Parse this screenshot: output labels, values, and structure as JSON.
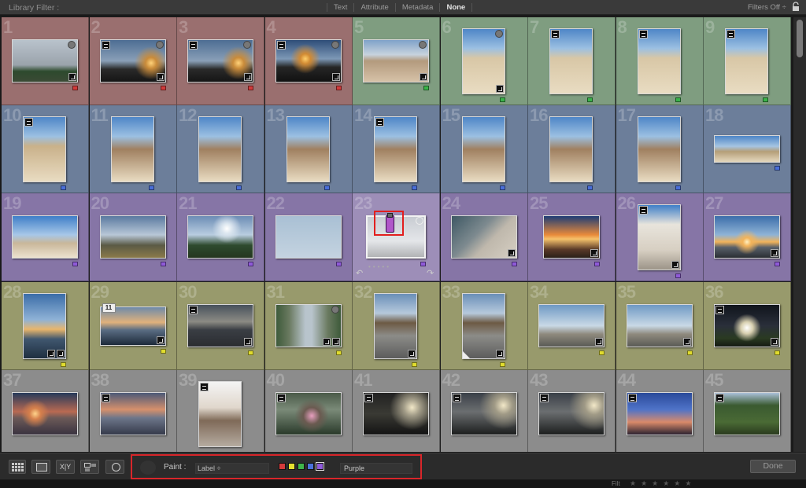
{
  "filter_bar": {
    "title": "Library Filter :",
    "tabs": [
      "Text",
      "Attribute",
      "Metadata",
      "None"
    ],
    "active_tab": "None",
    "filters_label": "Filters Off ÷"
  },
  "grid": {
    "row_colors": [
      "#9a6f6f",
      "#7a9a7a",
      "#6b7d99",
      "#8878a5",
      "#999a6b",
      "#8a8a8a"
    ],
    "label_colors": {
      "red": "#d13b3b",
      "green": "#3bb34a",
      "blue": "#4a6fd8",
      "purple": "#8f5ad8",
      "yellow": "#e0dc2e"
    },
    "cells": [
      {
        "num": "1",
        "bg": "#9a6f6f",
        "label": "red"
      },
      {
        "num": "2",
        "bg": "#9a6f6f",
        "label": "red"
      },
      {
        "num": "3",
        "bg": "#9a6f6f",
        "label": "red"
      },
      {
        "num": "4",
        "bg": "#9a6f6f",
        "label": "red"
      },
      {
        "num": "5",
        "bg": "#7f9d80",
        "label": "green"
      },
      {
        "num": "6",
        "bg": "#7f9d80",
        "label": "green"
      },
      {
        "num": "7",
        "bg": "#7f9d80",
        "label": "green"
      },
      {
        "num": "8",
        "bg": "#7f9d80",
        "label": "green"
      },
      {
        "num": "9",
        "bg": "#7f9d80",
        "label": "green"
      },
      {
        "num": "10",
        "bg": "#6c7e9a",
        "label": "blue"
      },
      {
        "num": "11",
        "bg": "#6c7e9a",
        "label": "blue"
      },
      {
        "num": "12",
        "bg": "#6c7e9a",
        "label": "blue"
      },
      {
        "num": "13",
        "bg": "#6c7e9a",
        "label": "blue"
      },
      {
        "num": "14",
        "bg": "#6c7e9a",
        "label": "blue"
      },
      {
        "num": "15",
        "bg": "#6c7e9a",
        "label": "blue"
      },
      {
        "num": "16",
        "bg": "#6c7e9a",
        "label": "blue"
      },
      {
        "num": "17",
        "bg": "#6c7e9a",
        "label": "blue"
      },
      {
        "num": "18",
        "bg": "#6c7e9a",
        "label": "blue"
      },
      {
        "num": "19",
        "bg": "#8675a6",
        "label": "purple"
      },
      {
        "num": "20",
        "bg": "#8675a6",
        "label": "purple"
      },
      {
        "num": "21",
        "bg": "#8675a6",
        "label": "purple"
      },
      {
        "num": "22",
        "bg": "#8675a6",
        "label": "purple"
      },
      {
        "num": "23",
        "bg": "#9d8eb8",
        "label": "purple"
      },
      {
        "num": "24",
        "bg": "#8675a6",
        "label": "purple"
      },
      {
        "num": "25",
        "bg": "#8675a6",
        "label": "purple"
      },
      {
        "num": "26",
        "bg": "#8675a6",
        "label": "purple"
      },
      {
        "num": "27",
        "bg": "#8675a6",
        "label": "purple"
      },
      {
        "num": "28",
        "bg": "#989a6c",
        "label": "yellow"
      },
      {
        "num": "29",
        "bg": "#989a6c",
        "label": "yellow"
      },
      {
        "num": "30",
        "bg": "#989a6c",
        "label": "yellow"
      },
      {
        "num": "31",
        "bg": "#989a6c",
        "label": "yellow"
      },
      {
        "num": "32",
        "bg": "#989a6c",
        "label": "yellow"
      },
      {
        "num": "33",
        "bg": "#989a6c",
        "label": "yellow"
      },
      {
        "num": "34",
        "bg": "#989a6c",
        "label": "yellow"
      },
      {
        "num": "35",
        "bg": "#989a6c",
        "label": "yellow"
      },
      {
        "num": "36",
        "bg": "#989a6c",
        "label": "yellow"
      },
      {
        "num": "37",
        "bg": "#8c8c8c",
        "label": ""
      },
      {
        "num": "38",
        "bg": "#8c8c8c",
        "label": ""
      },
      {
        "num": "39",
        "bg": "#8c8c8c",
        "label": ""
      },
      {
        "num": "40",
        "bg": "#8c8c8c",
        "label": ""
      },
      {
        "num": "41",
        "bg": "#8c8c8c",
        "label": ""
      },
      {
        "num": "42",
        "bg": "#8c8c8c",
        "label": ""
      },
      {
        "num": "43",
        "bg": "#8c8c8c",
        "label": ""
      },
      {
        "num": "44",
        "bg": "#8c8c8c",
        "label": ""
      },
      {
        "num": "45",
        "bg": "#8c8c8c",
        "label": ""
      }
    ],
    "stack_count": "11"
  },
  "toolbar": {
    "paint_label": "Paint :",
    "paint_mode": "Label ÷",
    "swatches": [
      "#d43b3b",
      "#e5e030",
      "#3fb54a",
      "#4a70d9",
      "#8e5ad9"
    ],
    "active_swatch": "#8e5ad9",
    "paint_value": "Purple",
    "compare_label": "X|Y",
    "done_label": "Done"
  },
  "bottom_strip": {
    "filter_label": "Filt"
  }
}
